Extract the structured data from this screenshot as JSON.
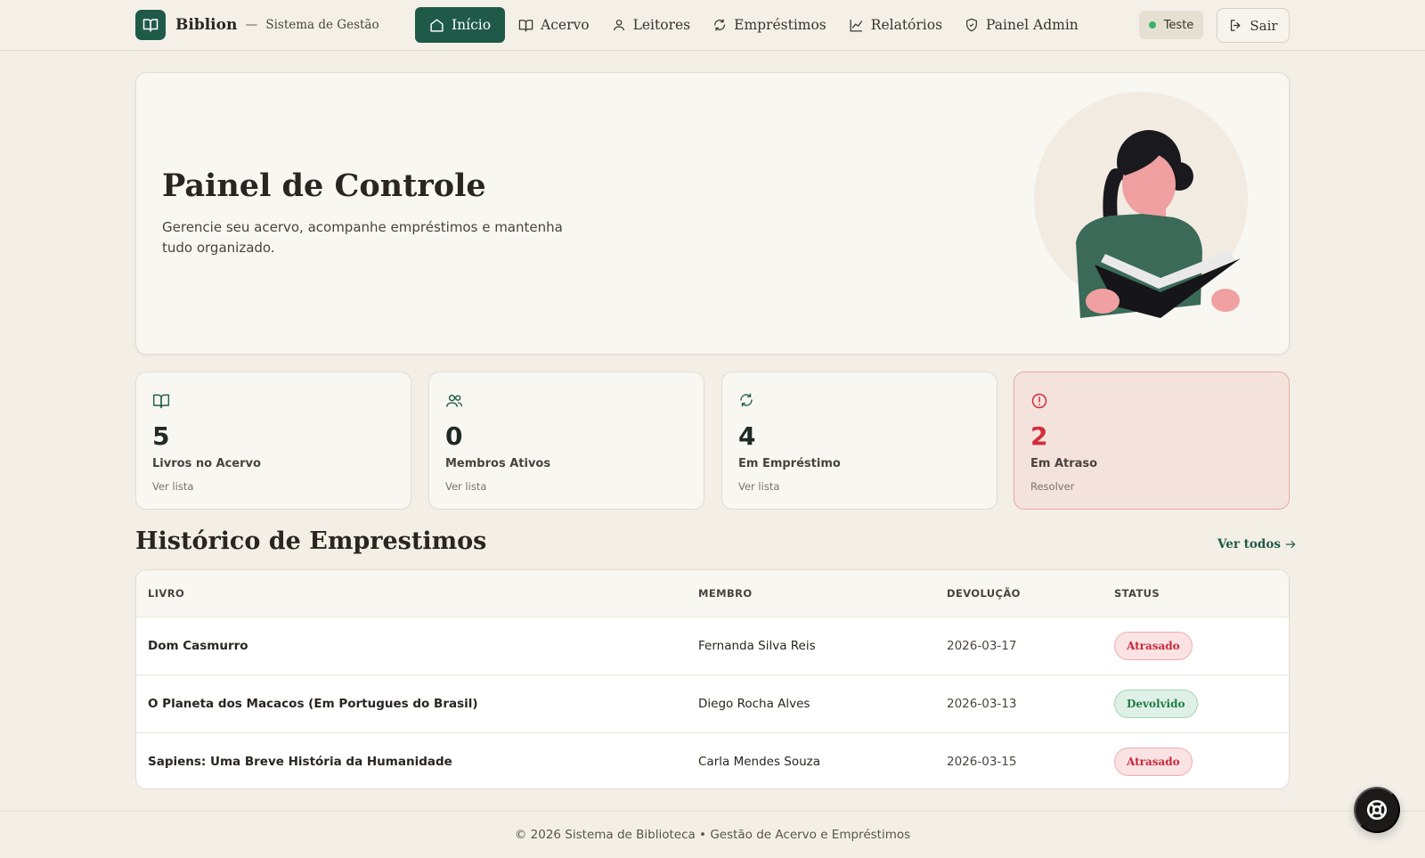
{
  "header": {
    "brand_name": "Biblion",
    "brand_separator": "—",
    "brand_subtitle": "Sistema de Gestão",
    "nav": [
      {
        "label": "Início",
        "icon": "home-icon",
        "active": true
      },
      {
        "label": "Acervo",
        "icon": "book-icon"
      },
      {
        "label": "Leitores",
        "icon": "user-icon"
      },
      {
        "label": "Empréstimos",
        "icon": "refresh-icon"
      },
      {
        "label": "Relatórios",
        "icon": "chart-line-icon"
      },
      {
        "label": "Painel Admin",
        "icon": "shield-icon"
      }
    ],
    "env_label": "Teste",
    "logout_label": "Sair"
  },
  "hero": {
    "title": "Painel de Controle",
    "description": "Gerencie seu acervo, acompanhe empréstimos e mantenha tudo organizado."
  },
  "stats": [
    {
      "value": "5",
      "label": "Livros no Acervo",
      "link": "Ver lista",
      "icon": "book-icon"
    },
    {
      "value": "0",
      "label": "Membros Ativos",
      "link": "Ver lista",
      "icon": "users-icon"
    },
    {
      "value": "4",
      "label": "Em Empréstimo",
      "link": "Ver lista",
      "icon": "refresh-icon"
    },
    {
      "value": "2",
      "label": "Em Atraso",
      "link": "Resolver",
      "icon": "alert-icon"
    }
  ],
  "history": {
    "title": "Histórico de Emprestimos",
    "see_all": "Ver todos",
    "columns": [
      "LIVRO",
      "MEMBRO",
      "DEVOLUÇÃO",
      "STATUS"
    ],
    "rows": [
      {
        "book": "Dom Casmurro",
        "member": "Fernanda Silva Reis",
        "due": "2026-03-17",
        "status": "Atrasado"
      },
      {
        "book": "O Planeta dos Macacos (Em Portugues do Brasil)",
        "member": "Diego Rocha Alves",
        "due": "2026-03-13",
        "status": "Devolvido"
      },
      {
        "book": "Sapiens: Uma Breve História da Humanidade",
        "member": "Carla Mendes Souza",
        "due": "2026-03-15",
        "status": "Atrasado"
      }
    ]
  },
  "footer": "© 2026 Sistema de Biblioteca • Gestão de Acervo e Empréstimos",
  "colors": {
    "primary": "#1f5a48",
    "danger": "#d42c3a",
    "success": "#1f7a46",
    "background": "#f3efe7"
  }
}
